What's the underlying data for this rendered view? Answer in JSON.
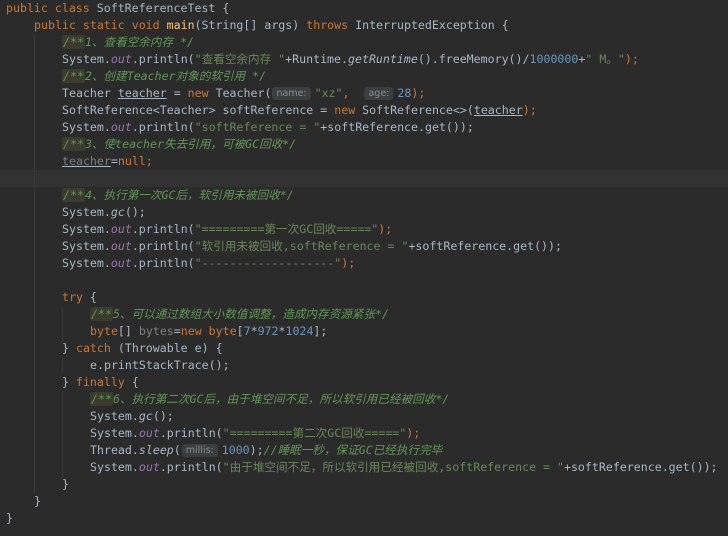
{
  "editor": {
    "lines": [
      {
        "indent": 0,
        "guides": [],
        "tokens": [
          {
            "t": "public class ",
            "c": "kw"
          },
          {
            "t": "SoftReferenceTest {",
            "c": ""
          }
        ]
      },
      {
        "indent": 1,
        "guides": [],
        "tokens": [
          {
            "t": "public static void ",
            "c": "kw"
          },
          {
            "t": "main",
            "c": "fn"
          },
          {
            "t": "(String[] args) ",
            "c": ""
          },
          {
            "t": "throws ",
            "c": "kw"
          },
          {
            "t": "InterruptedException {",
            "c": ""
          }
        ]
      },
      {
        "indent": 2,
        "guides": [
          1
        ],
        "tokens": [
          {
            "t": "/**",
            "c": "cmt-tag"
          },
          {
            "t": "1、查看空余内存 */",
            "c": "cmt"
          }
        ]
      },
      {
        "indent": 2,
        "guides": [
          1
        ],
        "tokens": [
          {
            "t": "System.",
            "c": ""
          },
          {
            "t": "out",
            "c": "field"
          },
          {
            "t": ".println(",
            "c": ""
          },
          {
            "t": "\"查看空余内存 \"",
            "c": "str"
          },
          {
            "t": "+Runtime.",
            "c": ""
          },
          {
            "t": "getRuntime",
            "c": "static-call"
          },
          {
            "t": "().freeMemory()/",
            "c": ""
          },
          {
            "t": "1000000",
            "c": "num"
          },
          {
            "t": "+",
            "c": ""
          },
          {
            "t": "\" M。\"",
            "c": "str"
          },
          {
            "t": ");",
            "c": "kw"
          }
        ]
      },
      {
        "indent": 2,
        "guides": [
          1
        ],
        "tokens": [
          {
            "t": "/**",
            "c": "cmt-tag"
          },
          {
            "t": "2、创建Teacher对象的软引用 */",
            "c": "cmt"
          }
        ]
      },
      {
        "indent": 2,
        "guides": [
          1
        ],
        "tokens": [
          {
            "t": "Teacher ",
            "c": ""
          },
          {
            "t": "teacher",
            "c": "warn"
          },
          {
            "t": " = ",
            "c": ""
          },
          {
            "t": "new ",
            "c": "kw"
          },
          {
            "t": "Teacher(",
            "c": ""
          },
          {
            "t": "name:",
            "c": "hint"
          },
          {
            "t": "\"xz\"",
            "c": "str"
          },
          {
            "t": ",  ",
            "c": "kw"
          },
          {
            "t": "age:",
            "c": "hint"
          },
          {
            "t": "28",
            "c": "num"
          },
          {
            "t": ");",
            "c": "kw"
          }
        ]
      },
      {
        "indent": 2,
        "guides": [
          1
        ],
        "tokens": [
          {
            "t": "SoftReference<Teacher> softReference = ",
            "c": ""
          },
          {
            "t": "new ",
            "c": "kw"
          },
          {
            "t": "SoftReference<>(",
            "c": ""
          },
          {
            "t": "teacher",
            "c": "warn"
          },
          {
            "t": ");",
            "c": "kw"
          }
        ]
      },
      {
        "indent": 2,
        "guides": [
          1
        ],
        "tokens": [
          {
            "t": "System.",
            "c": ""
          },
          {
            "t": "out",
            "c": "field"
          },
          {
            "t": ".println(",
            "c": ""
          },
          {
            "t": "\"softReference = \"",
            "c": "str"
          },
          {
            "t": "+softReference.get());",
            "c": ""
          }
        ]
      },
      {
        "indent": 2,
        "guides": [
          1
        ],
        "tokens": [
          {
            "t": "/**",
            "c": "cmt-tag"
          },
          {
            "t": "3、使teacher失去引用，可被GC回收*/",
            "c": "cmt"
          }
        ]
      },
      {
        "indent": 2,
        "guides": [
          1
        ],
        "tokens": [
          {
            "t": "teacher",
            "c": "unused warn"
          },
          {
            "t": "=",
            "c": ""
          },
          {
            "t": "null",
            "c": "kw"
          },
          {
            "t": ";",
            "c": "kw"
          }
        ]
      },
      {
        "indent": 0,
        "guides": [
          1
        ],
        "current": true,
        "tokens": []
      },
      {
        "indent": 2,
        "guides": [
          1
        ],
        "tokens": [
          {
            "t": "/**",
            "c": "cmt-tag"
          },
          {
            "t": "4、执行第一次GC后，软引用未被回收*/",
            "c": "cmt"
          }
        ]
      },
      {
        "indent": 2,
        "guides": [
          1
        ],
        "tokens": [
          {
            "t": "System.",
            "c": ""
          },
          {
            "t": "gc",
            "c": "static-call"
          },
          {
            "t": "();",
            "c": ""
          }
        ]
      },
      {
        "indent": 2,
        "guides": [
          1
        ],
        "tokens": [
          {
            "t": "System.",
            "c": ""
          },
          {
            "t": "out",
            "c": "field"
          },
          {
            "t": ".println(",
            "c": ""
          },
          {
            "t": "\"=========第一次GC回收=====\"",
            "c": "str"
          },
          {
            "t": ");",
            "c": "kw"
          }
        ]
      },
      {
        "indent": 2,
        "guides": [
          1
        ],
        "tokens": [
          {
            "t": "System.",
            "c": ""
          },
          {
            "t": "out",
            "c": "field"
          },
          {
            "t": ".println(",
            "c": ""
          },
          {
            "t": "\"软引用未被回收,softReference = \"",
            "c": "str"
          },
          {
            "t": "+softReference.get());",
            "c": ""
          }
        ]
      },
      {
        "indent": 2,
        "guides": [
          1
        ],
        "tokens": [
          {
            "t": "System.",
            "c": ""
          },
          {
            "t": "out",
            "c": "field"
          },
          {
            "t": ".println(",
            "c": ""
          },
          {
            "t": "\"-------------------\"",
            "c": "str"
          },
          {
            "t": ");",
            "c": "kw"
          }
        ]
      },
      {
        "indent": 0,
        "guides": [
          1
        ],
        "tokens": []
      },
      {
        "indent": 2,
        "guides": [
          1
        ],
        "tokens": [
          {
            "t": "try ",
            "c": "kw"
          },
          {
            "t": "{",
            "c": ""
          }
        ]
      },
      {
        "indent": 3,
        "guides": [
          1,
          2
        ],
        "tokens": [
          {
            "t": "/**",
            "c": "cmt-tag"
          },
          {
            "t": "5、可以通过数组大小数值调整，造成内存资源紧张*/",
            "c": "cmt"
          }
        ]
      },
      {
        "indent": 3,
        "guides": [
          1,
          2
        ],
        "tokens": [
          {
            "t": "byte",
            "c": "kw"
          },
          {
            "t": "[] ",
            "c": ""
          },
          {
            "t": "bytes",
            "c": "unused"
          },
          {
            "t": "=",
            "c": ""
          },
          {
            "t": "new byte",
            "c": "kw"
          },
          {
            "t": "[",
            "c": ""
          },
          {
            "t": "7",
            "c": "num"
          },
          {
            "t": "*",
            "c": ""
          },
          {
            "t": "972",
            "c": "num"
          },
          {
            "t": "*",
            "c": ""
          },
          {
            "t": "1024",
            "c": "num"
          },
          {
            "t": "];",
            "c": ""
          }
        ]
      },
      {
        "indent": 2,
        "guides": [
          1
        ],
        "tokens": [
          {
            "t": "} ",
            "c": ""
          },
          {
            "t": "catch ",
            "c": "kw"
          },
          {
            "t": "(Throwable e) {",
            "c": ""
          }
        ]
      },
      {
        "indent": 3,
        "guides": [
          1,
          2
        ],
        "tokens": [
          {
            "t": "e.printStackTrace();",
            "c": ""
          }
        ]
      },
      {
        "indent": 2,
        "guides": [
          1
        ],
        "tokens": [
          {
            "t": "} ",
            "c": ""
          },
          {
            "t": "finally ",
            "c": "kw"
          },
          {
            "t": "{",
            "c": ""
          }
        ]
      },
      {
        "indent": 3,
        "guides": [
          1,
          2
        ],
        "tokens": [
          {
            "t": "/**",
            "c": "cmt-tag"
          },
          {
            "t": "6、执行第二次GC后，由于堆空间不足，所以软引用已经被回收*/",
            "c": "cmt"
          }
        ]
      },
      {
        "indent": 3,
        "guides": [
          1,
          2
        ],
        "tokens": [
          {
            "t": "System.",
            "c": ""
          },
          {
            "t": "gc",
            "c": "static-call"
          },
          {
            "t": "();",
            "c": ""
          }
        ]
      },
      {
        "indent": 3,
        "guides": [
          1,
          2
        ],
        "tokens": [
          {
            "t": "System.",
            "c": ""
          },
          {
            "t": "out",
            "c": "field"
          },
          {
            "t": ".println(",
            "c": ""
          },
          {
            "t": "\"=========第二次GC回收=====\"",
            "c": "str"
          },
          {
            "t": ");",
            "c": "kw"
          }
        ]
      },
      {
        "indent": 3,
        "guides": [
          1,
          2
        ],
        "tokens": [
          {
            "t": "Thread.",
            "c": ""
          },
          {
            "t": "sleep",
            "c": "static-call"
          },
          {
            "t": "(",
            "c": ""
          },
          {
            "t": "millis:",
            "c": "hint"
          },
          {
            "t": "1000",
            "c": "num"
          },
          {
            "t": ");",
            "c": ""
          },
          {
            "t": "//睡眠一秒，保证GC已经执行完毕",
            "c": "cmt"
          }
        ]
      },
      {
        "indent": 3,
        "guides": [
          1,
          2
        ],
        "tokens": [
          {
            "t": "System.",
            "c": ""
          },
          {
            "t": "out",
            "c": "field"
          },
          {
            "t": ".println(",
            "c": ""
          },
          {
            "t": "\"由于堆空间不足，所以软引用已经被回收,softReference = \"",
            "c": "str"
          },
          {
            "t": "+softReference.get());",
            "c": ""
          }
        ]
      },
      {
        "indent": 2,
        "guides": [
          1
        ],
        "tokens": [
          {
            "t": "}",
            "c": ""
          }
        ]
      },
      {
        "indent": 1,
        "guides": [],
        "tokens": [
          {
            "t": "}",
            "c": ""
          }
        ]
      },
      {
        "indent": 0,
        "guides": [],
        "tokens": [
          {
            "t": "}",
            "c": ""
          }
        ]
      }
    ]
  }
}
